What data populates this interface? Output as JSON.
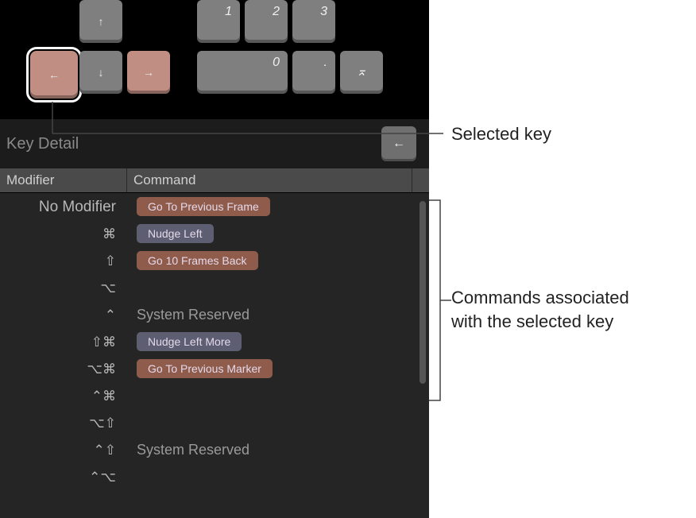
{
  "keyboard": {
    "up": {
      "glyph": "↑"
    },
    "left": {
      "glyph": "←"
    },
    "down": {
      "glyph": "↓"
    },
    "right": {
      "glyph": "→"
    },
    "num1": {
      "label": "1"
    },
    "num2": {
      "label": "2"
    },
    "num3": {
      "label": "3"
    },
    "num0": {
      "label": "0"
    },
    "numdot": {
      "label": "."
    },
    "numenter_glyph": "⌅"
  },
  "key_detail": {
    "title": "Key Detail",
    "selected_key_glyph": "←"
  },
  "columns": {
    "modifier": "Modifier",
    "command": "Command"
  },
  "rows": [
    {
      "modifier_text": "No Modifier",
      "nomod": true,
      "pill": {
        "label": "Go To Previous Frame",
        "color": "orange"
      }
    },
    {
      "modifier_text": "⌘",
      "pill": {
        "label": "Nudge Left",
        "color": "purple"
      }
    },
    {
      "modifier_text": "⇧",
      "pill": {
        "label": "Go 10 Frames Back",
        "color": "orange"
      }
    },
    {
      "modifier_text": "⌥",
      "pill": null
    },
    {
      "modifier_text": "⌃",
      "reserved": "System Reserved"
    },
    {
      "modifier_text": "⇧⌘",
      "pill": {
        "label": "Nudge Left More",
        "color": "purple"
      }
    },
    {
      "modifier_text": "⌥⌘",
      "pill": {
        "label": "Go To Previous Marker",
        "color": "orange"
      }
    },
    {
      "modifier_text": "⌃⌘",
      "pill": null
    },
    {
      "modifier_text": "⌥⇧",
      "pill": null
    },
    {
      "modifier_text": "⌃⇧",
      "reserved": "System Reserved"
    },
    {
      "modifier_text": "⌃⌥",
      "pill": null
    }
  ],
  "annotations": {
    "selected_key": "Selected key",
    "commands_line1": "Commands associated",
    "commands_line2": "with the selected key"
  }
}
